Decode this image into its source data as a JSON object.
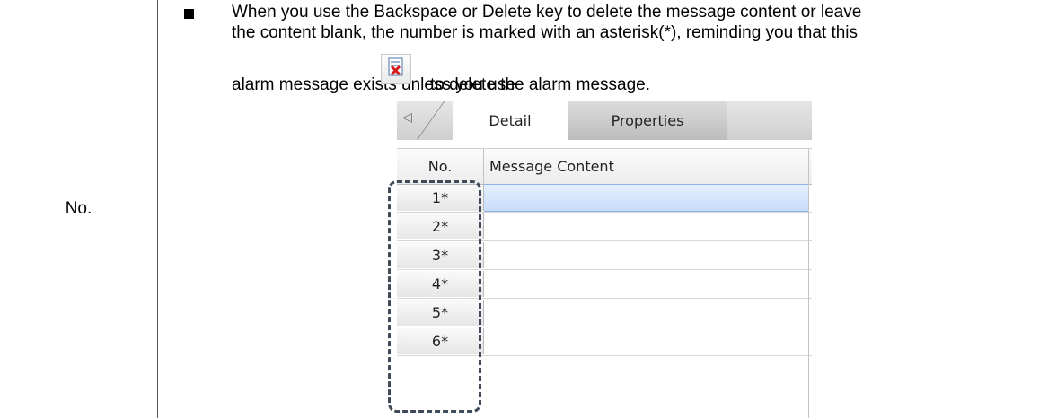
{
  "left_label": "No.",
  "note": {
    "line1": "When you use the Backspace or Delete key to delete the message content or leave",
    "line2": "the content blank, the number is marked with an asterisk(*), reminding you that this",
    "line3_start": "alarm message exists unless you use",
    "line3_end": "to delete the alarm message.",
    "icon": "delete-row-icon"
  },
  "panel": {
    "tabs": {
      "nav_arrow": "◁",
      "detail": "Detail",
      "properties": "Properties"
    },
    "columns": {
      "no": "No.",
      "message": "Message Content"
    },
    "rows": [
      {
        "no": "1*",
        "message": ""
      },
      {
        "no": "2*",
        "message": ""
      },
      {
        "no": "3*",
        "message": ""
      },
      {
        "no": "4*",
        "message": ""
      },
      {
        "no": "5*",
        "message": ""
      },
      {
        "no": "6*",
        "message": ""
      }
    ],
    "selected_row": 1
  }
}
